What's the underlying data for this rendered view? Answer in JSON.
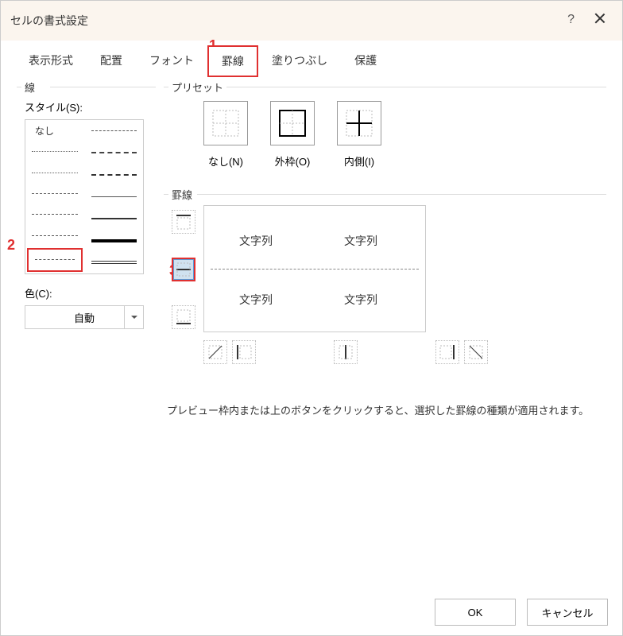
{
  "title": "セルの書式設定",
  "tabs": [
    "表示形式",
    "配置",
    "フォント",
    "罫線",
    "塗りつぶし",
    "保護"
  ],
  "callouts": {
    "c1": "1",
    "c2": "2",
    "c3": "3"
  },
  "line": {
    "group": "線",
    "styleLabel": "スタイル(S):",
    "none": "なし",
    "colorLabel": "色(C):",
    "colorValue": "自動"
  },
  "preset": {
    "group": "プリセット",
    "items": [
      {
        "label": "なし(N)"
      },
      {
        "label": "外枠(O)"
      },
      {
        "label": "内側(I)"
      }
    ]
  },
  "border": {
    "group": "罫線",
    "previewText": "文字列"
  },
  "hint": "プレビュー枠内または上のボタンをクリックすると、選択した罫線の種類が適用されます。",
  "footer": {
    "ok": "OK",
    "cancel": "キャンセル"
  }
}
